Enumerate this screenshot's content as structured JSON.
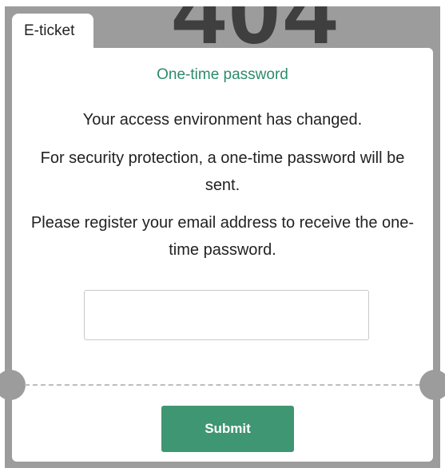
{
  "background": {
    "code_text": "404",
    "frame_color": "#9c9c9c"
  },
  "ticket": {
    "tab_label": "E-ticket",
    "title": "One-time password",
    "message_1": "Your access environment has changed.",
    "message_2": "For security protection, a one-time password will be sent.",
    "message_3": "Please register your email address to receive the one-time password.",
    "email_input": {
      "value": "",
      "placeholder": ""
    },
    "submit_label": "Submit"
  },
  "colors": {
    "accent": "#2e8b6c",
    "button": "#3f9672",
    "text": "#222222"
  }
}
